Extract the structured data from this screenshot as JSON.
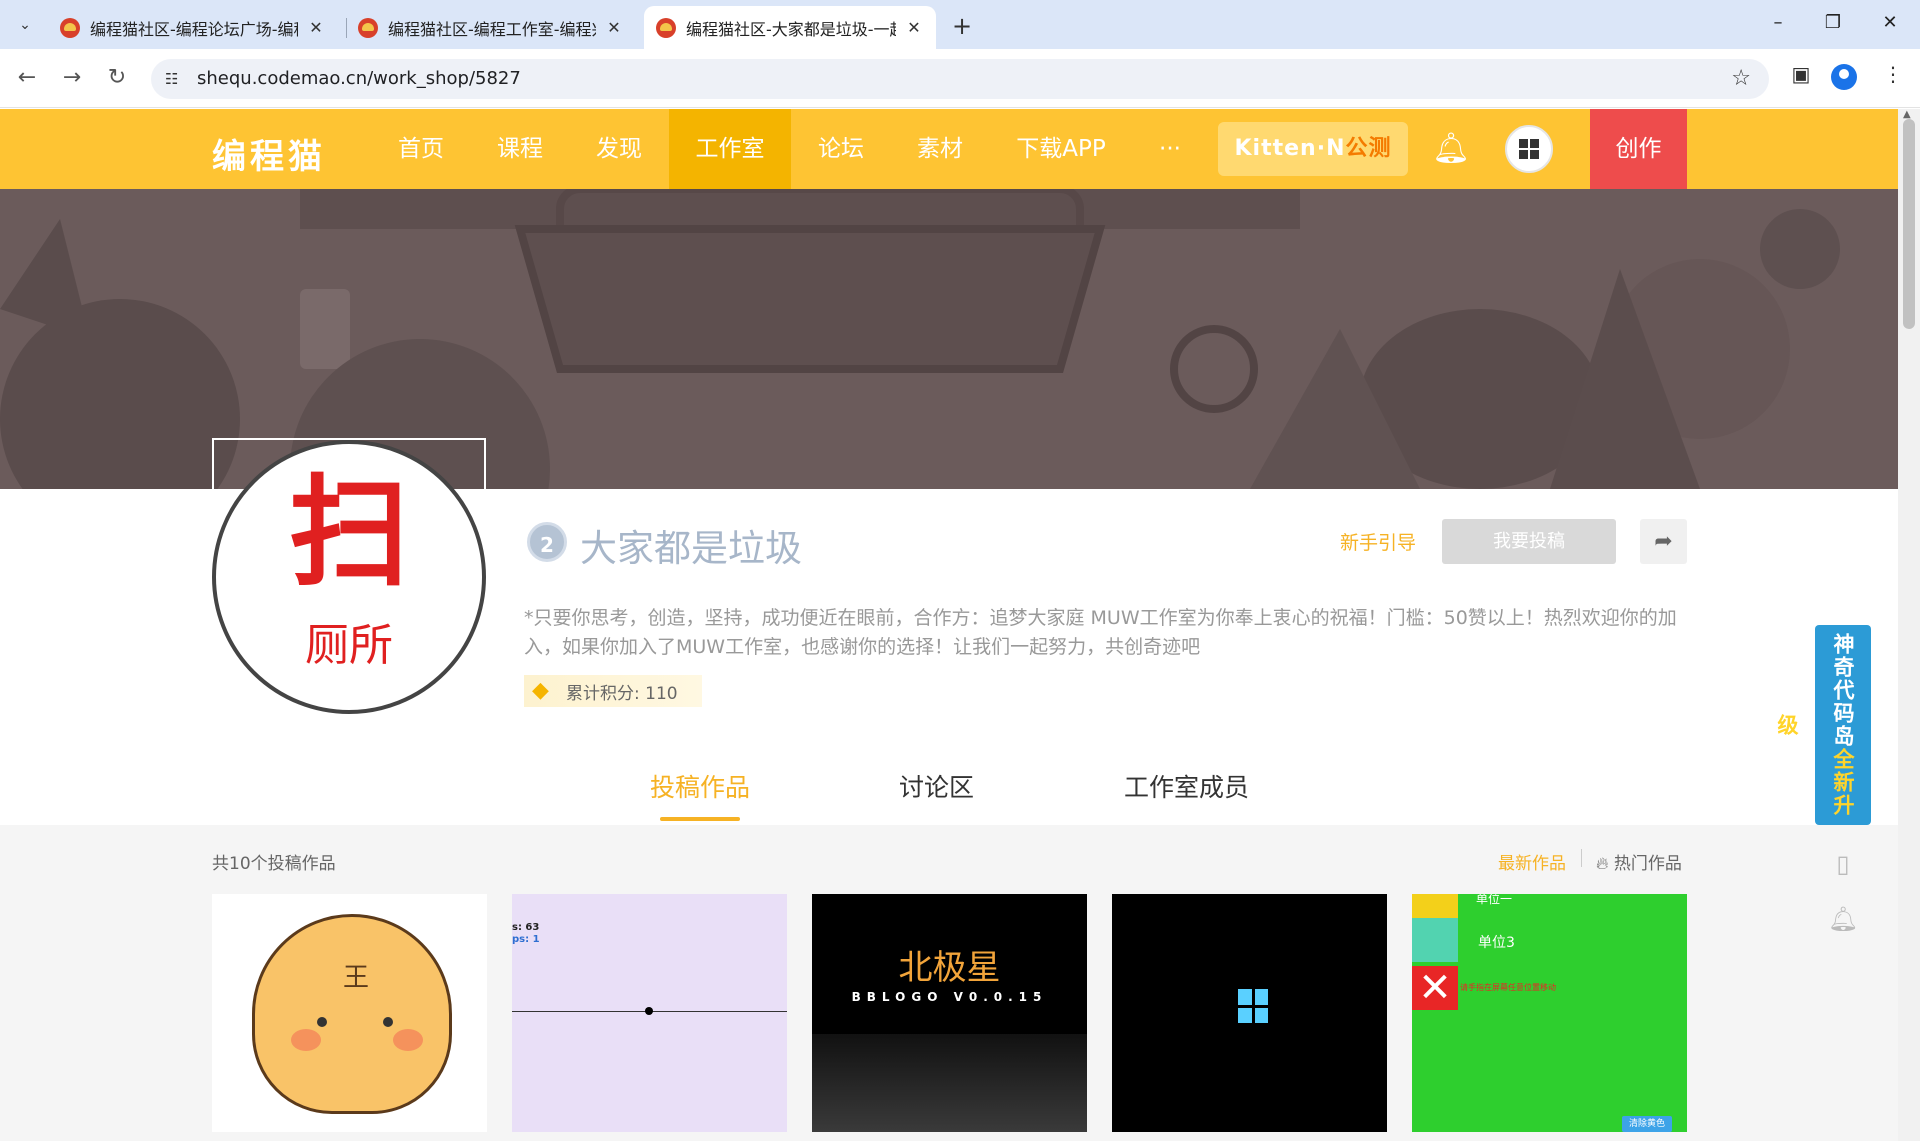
{
  "browser": {
    "tabs": [
      {
        "title": "编程猫社区-编程论坛广场-编程"
      },
      {
        "title": "编程猫社区-编程工作室-编程兴"
      },
      {
        "title": "编程猫社区-大家都是垃圾-一起"
      }
    ],
    "url": "shequ.codemao.cn/work_shop/5827"
  },
  "header": {
    "logo": "编程猫",
    "nav": [
      "首页",
      "课程",
      "发现",
      "工作室",
      "论坛",
      "素材",
      "下载APP",
      "···"
    ],
    "kitten_label": "Kitten·N",
    "kitten_tag": "公测",
    "create_label": "创作",
    "avatar_text": "Computer"
  },
  "studio": {
    "avatar_big": "扫",
    "avatar_small": "厕所",
    "level": "2",
    "name": "大家都是垃圾",
    "guide": "新手引导",
    "submit": "我要投稿",
    "description": "*只要你思考，创造，坚持，成功便近在眼前，合作方：追梦大家庭 MUW工作室为你奉上衷心的祝福！门槛：50赞以上！热烈欢迎你的加入，如果你加入了MUW工作室，也感谢你的选择！让我们一起努力，共创奇迹吧",
    "points_label": "累计积分: 110"
  },
  "tabs": [
    "投稿作品",
    "讨论区",
    "工作室成员"
  ],
  "works": {
    "count_label": "共10个投稿作品",
    "sort_new": "最新作品",
    "sort_hot": "热门作品",
    "card1": {
      "mark": "王"
    },
    "card2": {
      "line1": "s:  63",
      "line2": "ps:  1"
    },
    "card3": {
      "title": "北极星",
      "subtitle": "BBLOGO    V0.0.15"
    },
    "card5": {
      "label_top": "单位一",
      "label3": "单位3",
      "red_text": "请手指在屏幕任意位置移动",
      "clear_btn": "清除黄色"
    }
  },
  "floating": {
    "ad_text_a": "神奇代码岛",
    "ad_text_b": "全新升级"
  }
}
